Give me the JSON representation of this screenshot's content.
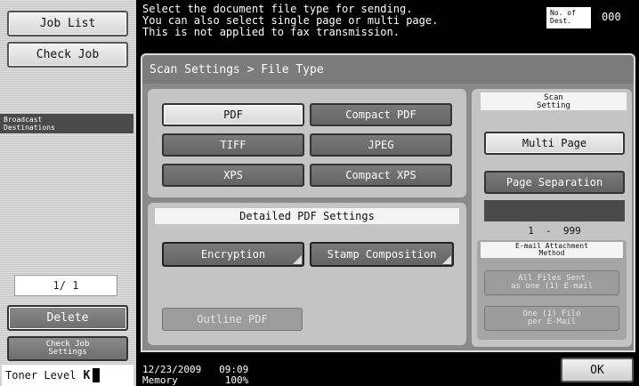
{
  "sidebar": {
    "job_list": "Job List",
    "check_job": "Check Job",
    "broadcast_destinations": "Broadcast\nDestinations",
    "page_indicator": "1/ 1",
    "delete": "Delete",
    "check_job_settings": "Check Job\nSettings",
    "toner_label": "Toner Level",
    "toner_color": "K"
  },
  "header": {
    "message": "Select the document file type for sending.\nYou can also select single page or multi page.\nThis is not applied to fax transmission.",
    "dest_label": "No. of\nDest.",
    "dest_count": "000"
  },
  "breadcrumb": "Scan Settings > File Type",
  "file_types": [
    "PDF",
    "Compact PDF",
    "TIFF",
    "JPEG",
    "XPS",
    "Compact XPS"
  ],
  "selected_file_type": "PDF",
  "detailed_pdf": {
    "label": "Detailed PDF Settings",
    "encryption": "Encryption",
    "stamp_composition": "Stamp Composition",
    "outline_pdf": "Outline PDF"
  },
  "scan_setting": {
    "label": "Scan\nSetting",
    "multi_page": "Multi Page",
    "page_separation": "Page Separation",
    "range": "1  -  999"
  },
  "email_attachment": {
    "label": "E-mail Attachment\nMethod",
    "all_files": "All Files Sent\nas one (1) E-mail",
    "one_file": "One (1) File\nper E-Mail"
  },
  "status": {
    "date": "12/23/2009",
    "time": "09:09",
    "memory_label": "Memory",
    "memory_value": "100%"
  },
  "ok_label": "OK"
}
